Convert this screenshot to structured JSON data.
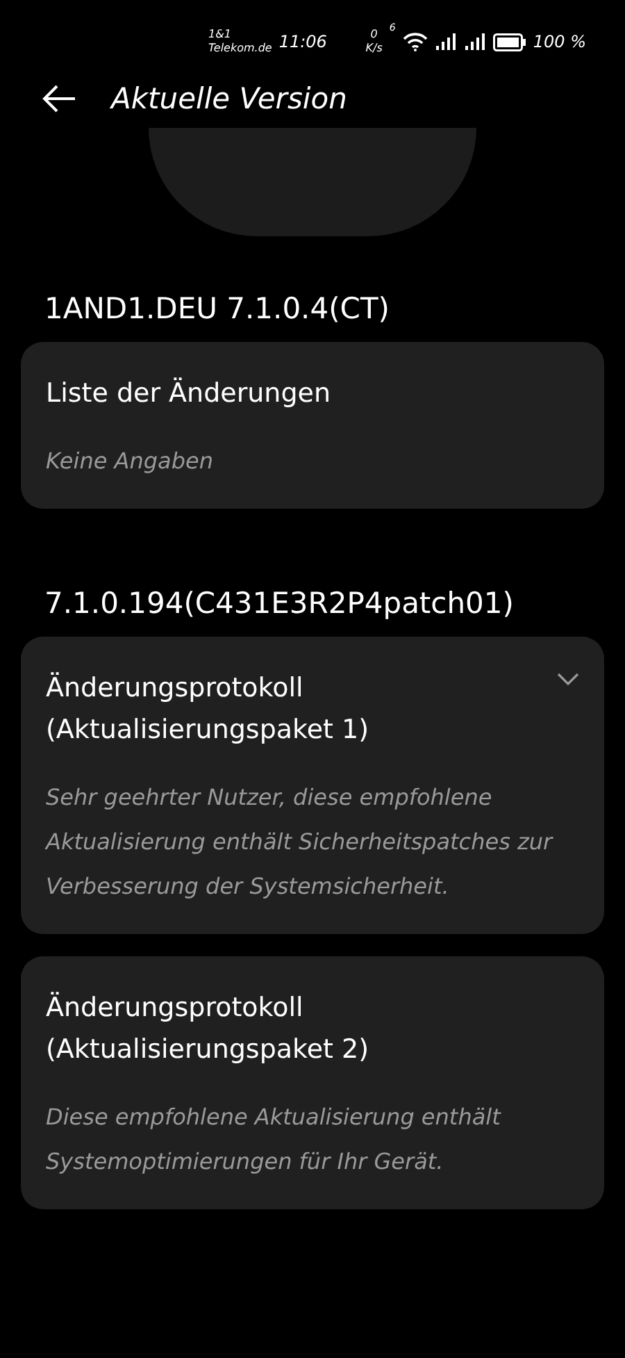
{
  "status_bar": {
    "carrier_lines": [
      "1&1",
      "Telekom.de"
    ],
    "time": "11:06",
    "speed_lines": [
      "0",
      "K/s"
    ],
    "wifi_label": "6",
    "battery": "100 %"
  },
  "header": {
    "title": "Aktuelle Version"
  },
  "sections": [
    {
      "version": "1AND1.DEU 7.1.0.4(CT)",
      "cards": [
        {
          "title": "Liste der Änderungen",
          "body": "Keine Angaben",
          "chevron": false
        }
      ]
    },
    {
      "version": "7.1.0.194(C431E3R2P4patch01)",
      "cards": [
        {
          "title": "Änderungsprotokoll (Aktualisierungspaket 1)",
          "body": "Sehr geehrter Nutzer, diese empfohlene Aktualisierung enthält Sicherheitspatches zur Verbesserung der Systemsicherheit.",
          "chevron": true
        },
        {
          "title": "Änderungsprotokoll (Aktualisierungspaket 2)",
          "body": "Diese empfohlene Aktualisierung enthält Systemoptimierungen für Ihr Gerät.",
          "chevron": false
        }
      ]
    }
  ]
}
